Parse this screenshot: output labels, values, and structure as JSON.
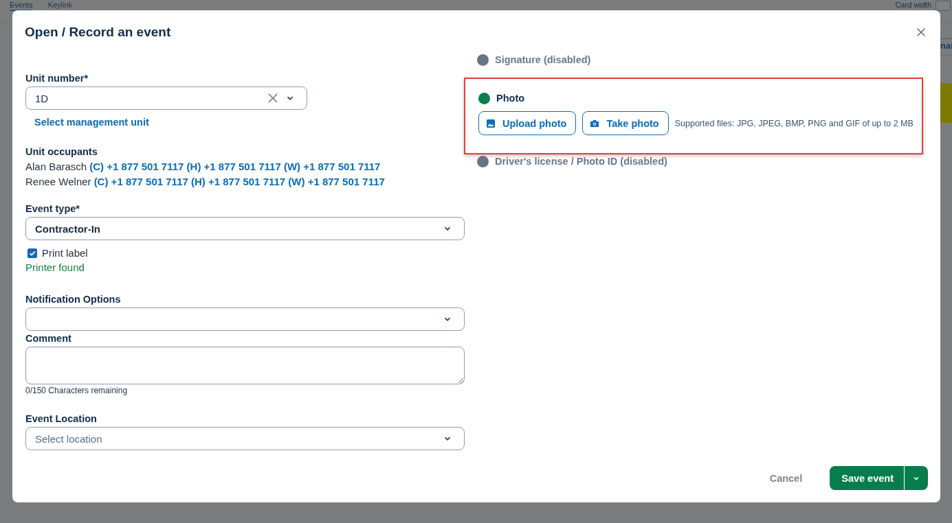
{
  "background": {
    "tabs": [
      {
        "label": "Events",
        "selected": true
      },
      {
        "label": "Keylink",
        "selected": false
      }
    ],
    "card_width_label": "Card width",
    "side_text": "nai"
  },
  "dialog": {
    "title": "Open / Record an event",
    "unit_number": {
      "label": "Unit number*",
      "value": "1D"
    },
    "management_link": "Select management unit",
    "occupants": {
      "label": "Unit occupants",
      "rows": [
        {
          "name": "Alan Barasch",
          "phones": "(C) +1 877 501 7117 (H) +1 877 501 7117 (W) +1 877 501 7117"
        },
        {
          "name": "Renee Welner",
          "phones": "(C) +1 877 501 7117 (H) +1 877 501 7117 (W) +1 877 501 7117"
        }
      ]
    },
    "event_type": {
      "label": "Event type*",
      "value": "Contractor-In"
    },
    "print_label": {
      "label": "Print label",
      "checked": true
    },
    "printer_status": "Printer found",
    "notification": {
      "label": "Notification Options"
    },
    "comment": {
      "label": "Comment",
      "counter": "0/150 Characters remaining"
    },
    "location": {
      "label": "Event Location",
      "placeholder": "Select location"
    },
    "attachments": [
      {
        "label": "Signature (disabled)",
        "disabled": true,
        "highlighted": false
      },
      {
        "label": "Photo",
        "disabled": false,
        "highlighted": true,
        "buttons": [
          {
            "kind": "upload",
            "label": "Upload photo"
          },
          {
            "kind": "camera",
            "label": "Take photo"
          }
        ],
        "note": "Supported files: JPG, JPEG, BMP, PNG and GIF of up to 2 MB"
      },
      {
        "label": "Driver's license / Photo ID (disabled)",
        "disabled": true,
        "highlighted": false
      }
    ],
    "cancel": "Cancel",
    "save": "Save event"
  }
}
